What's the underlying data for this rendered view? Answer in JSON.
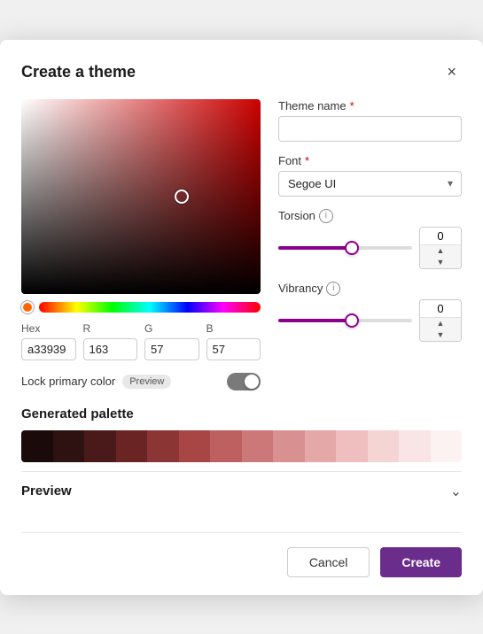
{
  "dialog": {
    "title": "Create a theme",
    "close_label": "×"
  },
  "color_picker": {
    "hex_label": "Hex",
    "r_label": "R",
    "g_label": "G",
    "b_label": "B",
    "hex_value": "a33939",
    "r_value": "163",
    "g_value": "57",
    "b_value": "57"
  },
  "lock_primary": {
    "label": "Lock primary color",
    "badge": "Preview"
  },
  "right_panel": {
    "theme_name_label": "Theme name",
    "theme_name_placeholder": "",
    "font_label": "Font",
    "font_value": "Segoe UI",
    "torsion_label": "Torsion",
    "torsion_value": "0",
    "vibrancy_label": "Vibrancy",
    "vibrancy_value": "0"
  },
  "palette": {
    "title": "Generated palette",
    "swatches": [
      "#1a0a0a",
      "#2e1111",
      "#4a1a1a",
      "#6b2424",
      "#8b3535",
      "#a84545",
      "#bf6060",
      "#cc7878",
      "#d99090",
      "#e5a8a8",
      "#efbfbf",
      "#f5d4d4",
      "#f9e5e5",
      "#fdf2f2"
    ]
  },
  "preview_section": {
    "title": "Preview"
  },
  "footer": {
    "cancel_label": "Cancel",
    "create_label": "Create"
  }
}
